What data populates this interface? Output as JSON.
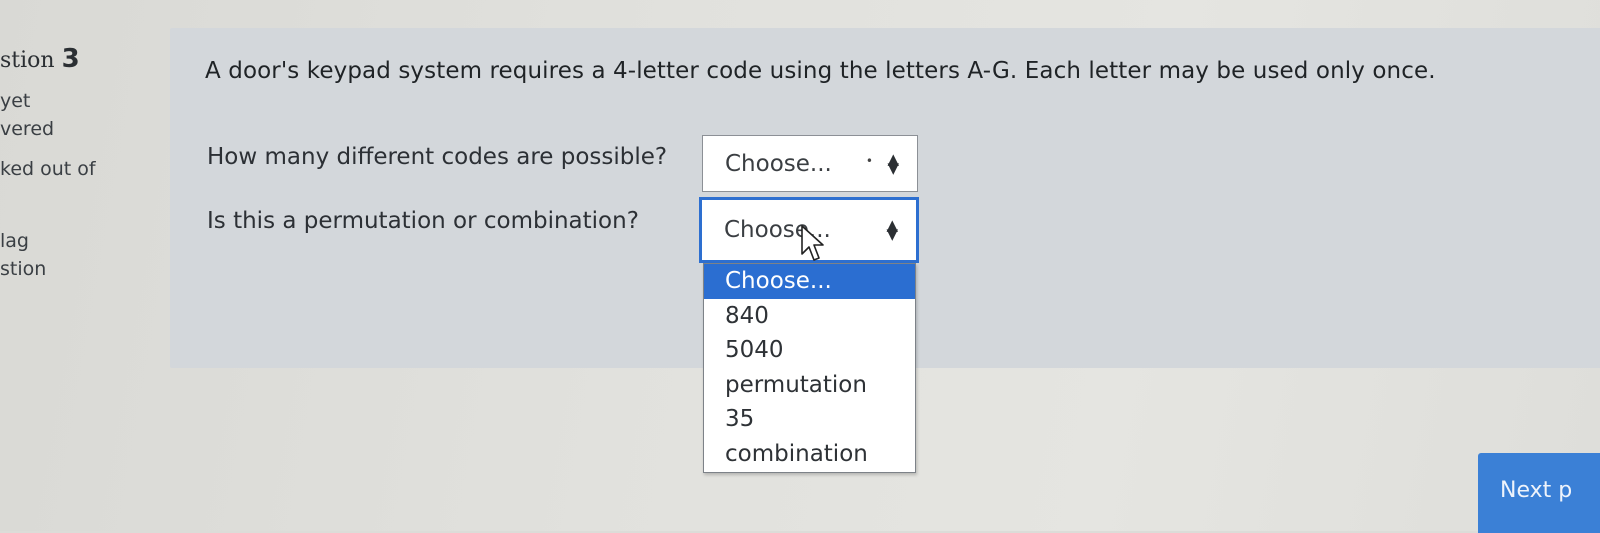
{
  "sidebar": {
    "title": "stion",
    "number": "3",
    "status_line1": "yet",
    "status_line2": "vered",
    "marks_text": "ked out of",
    "flag_line1": "lag",
    "flag_line2": "stion"
  },
  "question": {
    "stem": "A door's keypad system requires a 4-letter code using the letters A-G. Each letter may be used only once.",
    "part1_prompt": "How many different codes are possible?",
    "part1_selected": "Choose...",
    "part2_prompt": "Is this a permutation or combination?",
    "part2_selected": "Choose...",
    "options": [
      "Choose...",
      "840",
      "5040",
      "permutation",
      "35",
      "combination"
    ]
  },
  "footer": {
    "next_label": "Next p"
  },
  "colors": {
    "accent": "#2b6ed1",
    "panel": "#d3d7db",
    "button": "#3b80d6"
  }
}
